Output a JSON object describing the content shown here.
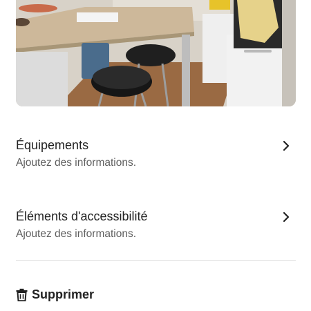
{
  "photo": {
    "icon": "kitchen-listing-photo"
  },
  "sections": [
    {
      "title": "Équipements",
      "subtitle": "Ajoutez des informations.",
      "icon": "chevron-right-icon"
    },
    {
      "title": "Éléments d'accessibilité",
      "subtitle": "Ajoutez des informations.",
      "icon": "chevron-right-icon"
    }
  ],
  "delete": {
    "label": "Supprimer",
    "icon": "trash-icon"
  },
  "colors": {
    "text": "#222222",
    "secondary": "#5e5e5e",
    "divider": "#dddddd"
  }
}
